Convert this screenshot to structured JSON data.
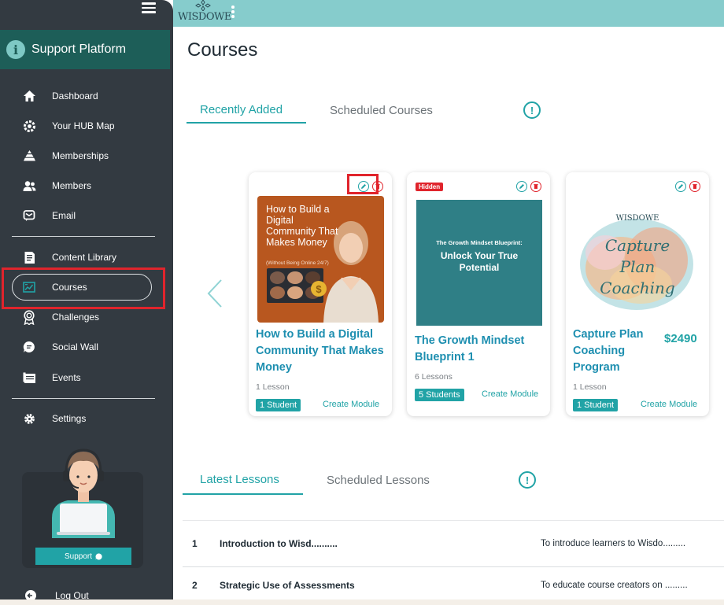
{
  "app": {
    "name": "Support Platform",
    "logo_text": "WISDOWE"
  },
  "sidebar": {
    "items": [
      {
        "label": "Dashboard",
        "icon": "home-icon"
      },
      {
        "label": "Your HUB Map",
        "icon": "gear-map-icon"
      },
      {
        "label": "Memberships",
        "icon": "pyramid-icon"
      },
      {
        "label": "Members",
        "icon": "users-icon"
      },
      {
        "label": "Email",
        "icon": "email-icon"
      },
      {
        "label": "Content Library",
        "icon": "document-icon"
      },
      {
        "label": "Courses",
        "icon": "chart-board-icon",
        "active": true
      },
      {
        "label": "Challenges",
        "icon": "award-icon"
      },
      {
        "label": "Social Wall",
        "icon": "chat-bubble-icon"
      },
      {
        "label": "Events",
        "icon": "calendar-icon"
      },
      {
        "label": "Settings",
        "icon": "gear-icon"
      }
    ],
    "support_button": "Support",
    "logout": "Log Out"
  },
  "page": {
    "title": "Courses"
  },
  "course_tabs": {
    "recent": "Recently Added",
    "scheduled": "Scheduled Courses"
  },
  "courses": [
    {
      "title": "How to Build a Digital Community That Makes Money",
      "thumb_headline": "How to Build a Digital Community That Makes Money",
      "thumb_sub": "(Without Being Online 24/7)",
      "lessons": "1 Lesson",
      "students": "1 Student",
      "create": "Create Module"
    },
    {
      "hidden_badge": "Hidden",
      "title": "The Growth Mindset Blueprint 1",
      "thumb_small": "The Growth Mindset Blueprint:",
      "thumb_big": "Unlock Your True Potential",
      "lessons": "6 Lessons",
      "students": "5 Students",
      "create": "Create Module"
    },
    {
      "title": "Capture Plan Coaching Program",
      "thumb_logo": "WISDOWE",
      "thumb_script": "Capture Plan Coaching",
      "price": "$2490",
      "lessons": "1 Lesson",
      "students": "1 Student",
      "create": "Create Module"
    }
  ],
  "lesson_tabs": {
    "latest": "Latest Lessons",
    "scheduled": "Scheduled Lessons"
  },
  "lessons": [
    {
      "num": "1",
      "title": "Introduction to Wisd..........",
      "desc": "To introduce learners to Wisdo........."
    },
    {
      "num": "2",
      "title": "Strategic Use of Assessments",
      "desc": "To educate course creators on ........."
    }
  ],
  "colors": {
    "accent": "#21a3a6",
    "sidebar": "#333a41",
    "topbar": "#86cccc",
    "highlight": "#e0242c",
    "course_title": "#1e8fb0"
  }
}
